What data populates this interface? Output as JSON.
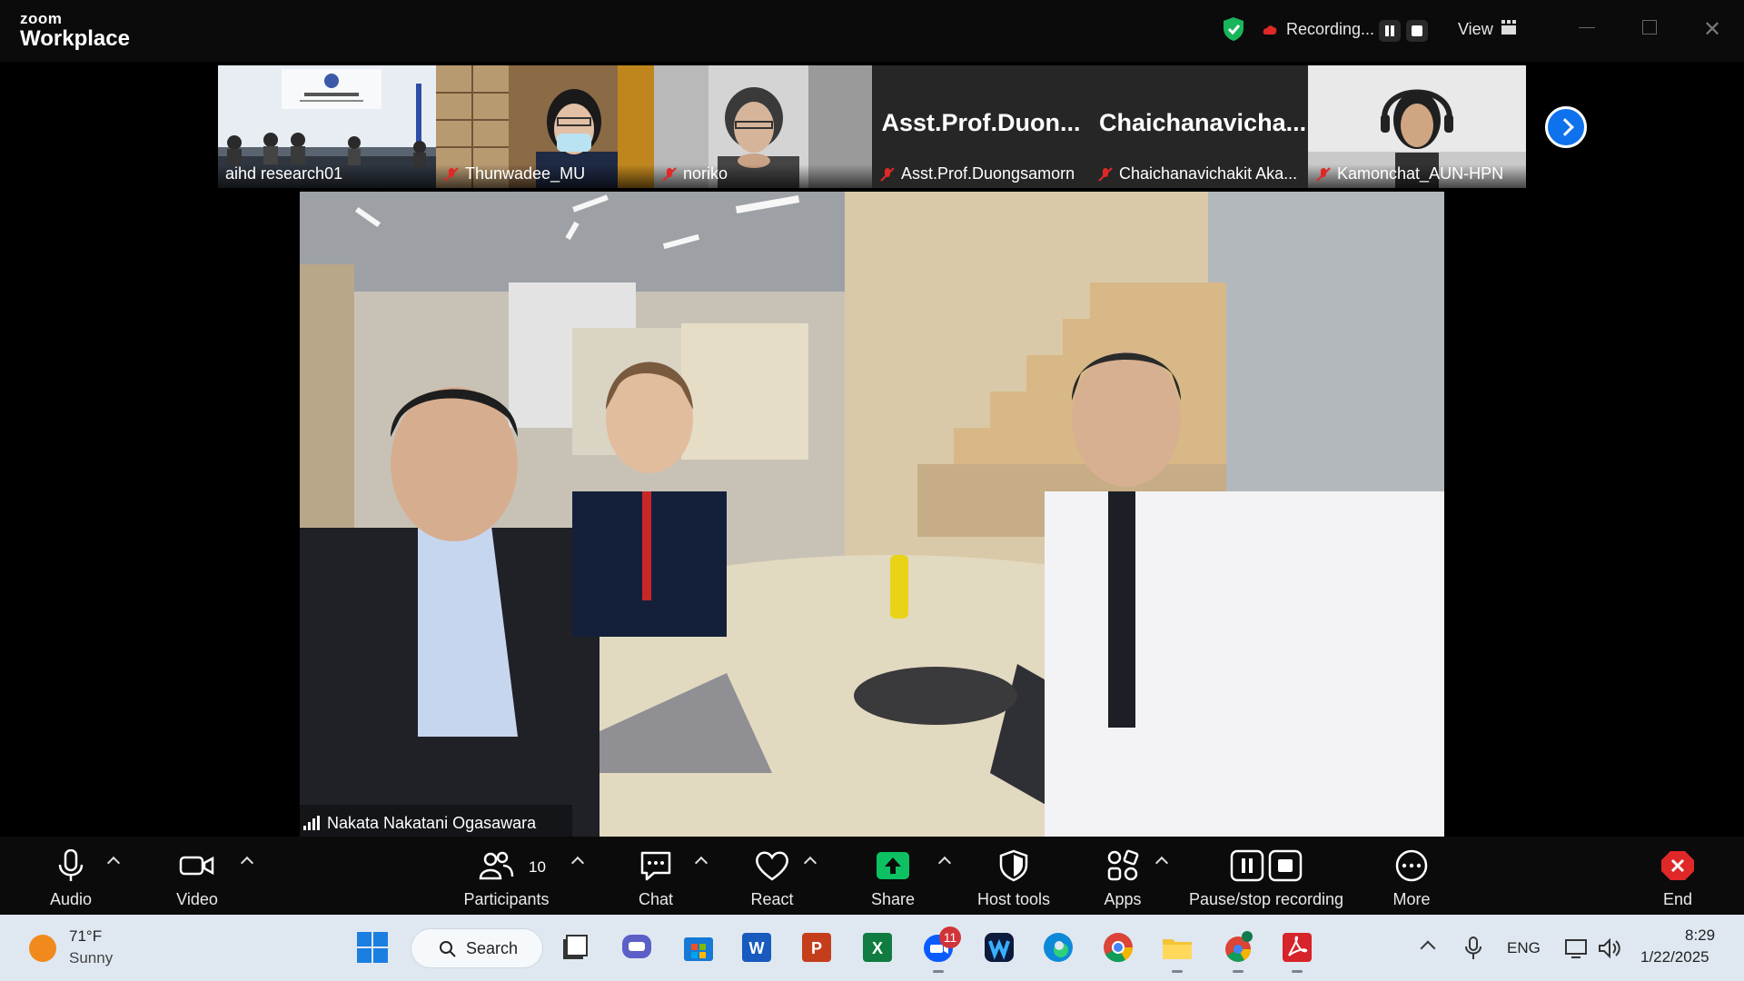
{
  "titlebar": {
    "brand_small": "zoom",
    "brand_large": "Workplace",
    "recording_label": "Recording...",
    "view_label": "View"
  },
  "participants_strip": [
    {
      "name": "aihd research01",
      "muted": false,
      "video": true
    },
    {
      "name": "Thunwadee_MU",
      "muted": true,
      "video": true
    },
    {
      "name": "noriko",
      "muted": true,
      "video": true
    },
    {
      "name": "Asst.Prof.Duongsamorn",
      "display_big": "Asst.Prof.Duon...",
      "muted": true,
      "video": false
    },
    {
      "name": "Chaichanavichakit Aka...",
      "display_big": "Chaichanavicha...",
      "muted": true,
      "video": false
    },
    {
      "name": "Kamonchat_AUN-HPN",
      "muted": true,
      "video": true
    }
  ],
  "main_video": {
    "speaker_name": "Nakata Nakatani Ogasawara"
  },
  "controls": {
    "audio": "Audio",
    "video": "Video",
    "participants": "Participants",
    "participants_count": "10",
    "chat": "Chat",
    "react": "React",
    "share": "Share",
    "host_tools": "Host tools",
    "apps": "Apps",
    "pause_stop": "Pause/stop recording",
    "more": "More",
    "end": "End"
  },
  "taskbar": {
    "weather_temp": "71°F",
    "weather_cond": "Sunny",
    "search_label": "Search",
    "zoom_badge": "11",
    "lang": "ENG",
    "time": "8:29",
    "date": "1/22/2025"
  },
  "colors": {
    "accent_blue": "#0e72ed",
    "share_green": "#0dc163",
    "end_red": "#e02828"
  }
}
